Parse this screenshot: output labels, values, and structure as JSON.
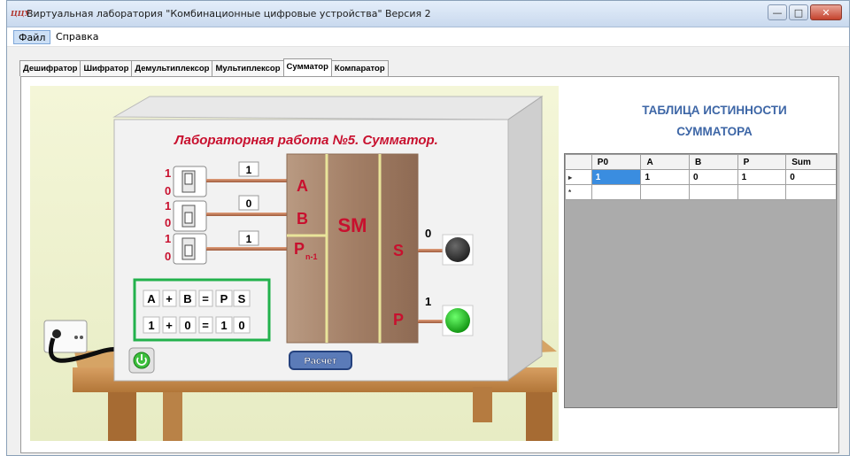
{
  "window": {
    "title": "Виртуальная лаборатория \"Комбинационные цифровые устройства\" Версия 2",
    "icon_text": "ЦЦУ",
    "buttons": [
      "minimize-icon",
      "maximize-icon",
      "close-icon"
    ]
  },
  "menu": [
    {
      "label": "Файл"
    },
    {
      "label": "Справка"
    }
  ],
  "tabs": [
    {
      "label": "Дешифратор"
    },
    {
      "label": "Шифратор"
    },
    {
      "label": "Демультиплексор"
    },
    {
      "label": "Мультиплексор"
    },
    {
      "label": "Сумматор",
      "active": true
    },
    {
      "label": "Компаратор"
    }
  ],
  "lab": {
    "heading": "Лабораторная работа №5. Сумматор.",
    "switches": [
      {
        "top": "1",
        "bottom": "0",
        "value": "1",
        "input": "A",
        "on": false
      },
      {
        "top": "1",
        "bottom": "0",
        "value": "0",
        "input": "B",
        "on": false
      },
      {
        "top": "1",
        "bottom": "0",
        "value": "1",
        "input": "P",
        "input_sub": "n-1",
        "on": false
      }
    ],
    "block_label": "SM",
    "outputs": [
      {
        "name": "S",
        "value": "0",
        "lamp": "off",
        "lamp_color": "#3a3a3a"
      },
      {
        "name": "P",
        "value": "1",
        "lamp": "on",
        "lamp_color": "#1fbf1f"
      }
    ],
    "equation": {
      "header": [
        "A",
        "+",
        "B",
        "=",
        "P",
        "S"
      ],
      "values": [
        "1",
        "+",
        "0",
        "=",
        "1",
        "0"
      ],
      "frame_color": "#22b14c"
    },
    "calc_button": "Расчет",
    "power_icon": "power-icon",
    "socket_icon": "power-outlet-icon",
    "colors": {
      "accent_red": "#c8102e",
      "sm_block": "#b08a6c",
      "wire": "#c07a55"
    }
  },
  "truth_table": {
    "title_line1": "ТАБЛИЦА ИСТИННОСТИ",
    "title_line2": "СУММАТОРА",
    "columns": [
      "P0",
      "A",
      "B",
      "P",
      "Sum"
    ],
    "rows": [
      {
        "marker": "▸",
        "cells": [
          "1",
          "1",
          "0",
          "1",
          "0"
        ]
      },
      {
        "marker": "*",
        "cells": [
          "",
          "",
          "",
          "",
          ""
        ]
      }
    ],
    "selected_cell": [
      0,
      0
    ]
  }
}
